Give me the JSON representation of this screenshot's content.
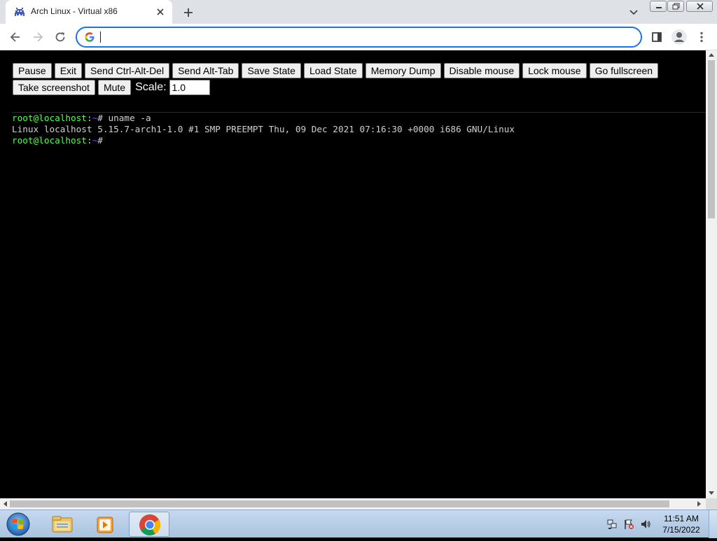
{
  "browser": {
    "tab": {
      "title": "Arch Linux - Virtual x86"
    },
    "omnibox": {
      "value": "",
      "placeholder": ""
    }
  },
  "controls": {
    "buttons_row1": [
      "Pause",
      "Exit",
      "Send Ctrl-Alt-Del",
      "Send Alt-Tab",
      "Save State",
      "Load State",
      "Memory Dump",
      "Disable mouse",
      "Lock mouse",
      "Go fullscreen"
    ],
    "buttons_row2": [
      "Take screenshot",
      "Mute"
    ],
    "scale_label": "Scale:",
    "scale_value": "1.0"
  },
  "terminal": {
    "lines": [
      {
        "user": "root@localhost",
        "sep": ":",
        "path": "~",
        "symbol": "#",
        "command": " uname -a"
      },
      {
        "output": "Linux localhost 5.15.7-arch1-1.0 #1 SMP PREEMPT Thu, 09 Dec 2021 07:16:30 +0000 i686 GNU/Linux"
      },
      {
        "user": "root@localhost",
        "sep": ":",
        "path": "~",
        "symbol": "#",
        "command": ""
      }
    ],
    "colors": {
      "user": "#54ff54",
      "path": "#5454ff",
      "text": "#d0d0d0",
      "background": "#000000"
    }
  },
  "taskbar": {
    "time": "11:51 AM",
    "date": "7/15/2022",
    "items": [
      "start-orb-icon",
      "windows-explorer-icon",
      "media-player-icon",
      "chrome-icon"
    ]
  },
  "icons": {
    "tab_favicon": "space-invader-icon",
    "accent": "#1a73e8"
  }
}
